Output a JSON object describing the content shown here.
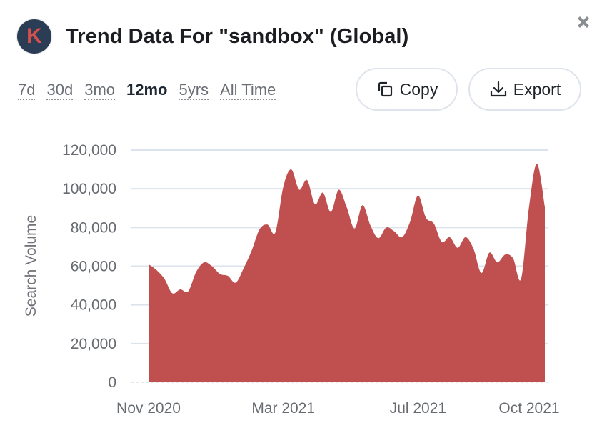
{
  "header": {
    "logo_letter": "K",
    "title": "Trend Data For \"sandbox\" (Global)"
  },
  "close_icon": "close-x-icon",
  "time_ranges": [
    {
      "label": "7d",
      "active": false
    },
    {
      "label": "30d",
      "active": false
    },
    {
      "label": "3mo",
      "active": false
    },
    {
      "label": "12mo",
      "active": true
    },
    {
      "label": "5yrs",
      "active": false
    },
    {
      "label": "All Time",
      "active": false
    }
  ],
  "buttons": {
    "copy_label": "Copy",
    "export_label": "Export"
  },
  "colors": {
    "area_fill": "#c05050",
    "grid": "#dbe3ec",
    "logo_bg": "#2b3d55",
    "logo_letter": "#d4504c"
  },
  "chart_data": {
    "type": "area",
    "title": "",
    "xlabel": "",
    "ylabel": "Search Volume",
    "ylim": [
      0,
      120000
    ],
    "yticks": [
      0,
      20000,
      40000,
      60000,
      80000,
      100000,
      120000
    ],
    "ytick_labels": [
      "0",
      "20,000",
      "40,000",
      "60,000",
      "80,000",
      "100,000",
      "120,000"
    ],
    "xtick_labels": [
      "Nov 2020",
      "Mar 2021",
      "Jul 2021",
      "Oct 2021"
    ],
    "xtick_index": [
      0,
      17,
      34,
      51
    ],
    "grid": true,
    "legend": "none",
    "series": [
      {
        "name": "sandbox",
        "values": [
          61000,
          58000,
          53500,
          46000,
          48000,
          47000,
          57000,
          62000,
          60000,
          56000,
          55000,
          51500,
          59000,
          68000,
          79000,
          81500,
          77500,
          101000,
          110000,
          99500,
          104500,
          92000,
          98000,
          88000,
          99500,
          90500,
          79500,
          91500,
          81000,
          74500,
          80000,
          78000,
          75000,
          83000,
          96500,
          85000,
          82000,
          72500,
          75000,
          69500,
          75000,
          69000,
          56500,
          67000,
          62000,
          66000,
          64000,
          53500,
          90500,
          113000,
          90500
        ]
      }
    ]
  }
}
